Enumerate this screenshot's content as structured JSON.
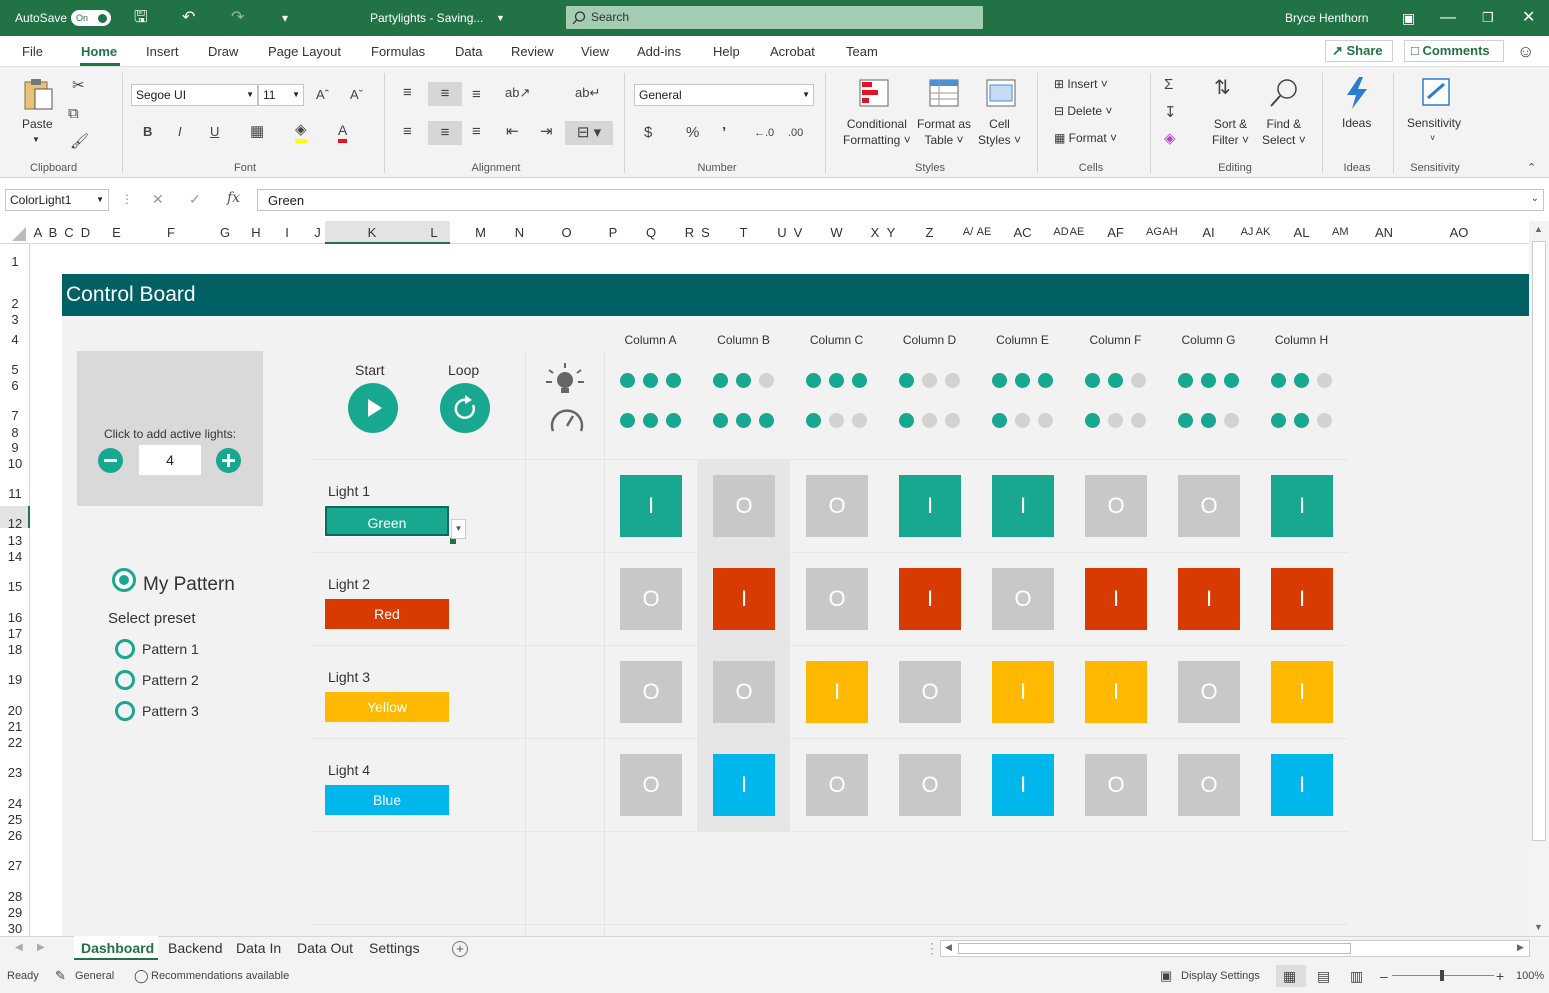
{
  "titlebar": {
    "autosave_label": "AutoSave",
    "autosave_state": "On",
    "doc_title": "Partylights  -  Saving...",
    "search_placeholder": "Search",
    "user": "Bryce Henthorn"
  },
  "menu": {
    "tabs": [
      "File",
      "Home",
      "Insert",
      "Draw",
      "Page Layout",
      "Formulas",
      "Data",
      "Review",
      "View",
      "Add-ins",
      "Help",
      "Acrobat",
      "Team"
    ],
    "active": "Home",
    "share": "Share",
    "comments": "Comments"
  },
  "ribbon": {
    "paste": "Paste",
    "clipboard": "Clipboard",
    "font_name": "Segoe UI",
    "font_size": "11",
    "font": "Font",
    "alignment": "Alignment",
    "number_format": "General",
    "number": "Number",
    "cond_format_1": "Conditional",
    "cond_format_2": "Formatting",
    "format_table_1": "Format as",
    "format_table_2": "Table",
    "cell_styles_1": "Cell",
    "cell_styles_2": "Styles",
    "styles": "Styles",
    "insert": "Insert",
    "delete": "Delete",
    "format": "Format",
    "cells": "Cells",
    "sort_1": "Sort &",
    "sort_2": "Filter",
    "find_1": "Find &",
    "find_2": "Select",
    "editing": "Editing",
    "ideas": "Ideas",
    "ideas_group": "Ideas",
    "sensitivity": "Sensitivity",
    "sensitivity_group": "Sensitivity"
  },
  "formula_bar": {
    "name_box": "ColorLight1",
    "fx": "fx",
    "value": "Green"
  },
  "columns": [
    "A",
    "B",
    "C",
    "D",
    "E",
    "F",
    "G",
    "H",
    "I",
    "J",
    "K",
    "L",
    "M",
    "N",
    "O",
    "P",
    "Q",
    "R",
    "S",
    "T",
    "U",
    "V",
    "W",
    "X",
    "Y",
    "Z",
    "A/",
    "AE",
    "AC",
    "AD",
    "AE",
    "AF",
    "AG",
    "AH",
    "AI",
    "AJ",
    "AK",
    "AL",
    "AM",
    "AN",
    "AO"
  ],
  "rows": [
    "1",
    "2",
    "3",
    "4",
    "5",
    "6",
    "7",
    "8",
    "9",
    "10",
    "11",
    "12",
    "13",
    "14",
    "15",
    "16",
    "17",
    "18",
    "19",
    "20",
    "21",
    "22",
    "23",
    "24",
    "25",
    "26",
    "27",
    "28",
    "29",
    "30"
  ],
  "dashboard": {
    "title": "Control Board",
    "add_lights_label": "Click to add active lights:",
    "active_lights": "4",
    "my_pattern": "My Pattern",
    "select_preset": "Select preset",
    "presets": [
      "Pattern 1",
      "Pattern 2",
      "Pattern 3"
    ],
    "start": "Start",
    "loop": "Loop",
    "column_headers": [
      "Column A",
      "Column B",
      "Column C",
      "Column D",
      "Column E",
      "Column F",
      "Column G",
      "Column H"
    ],
    "lights": [
      {
        "label": "Light 1",
        "color_name": "Green",
        "color": "#17a88f",
        "states": [
          "I",
          "O",
          "O",
          "I",
          "I",
          "O",
          "O",
          "I"
        ]
      },
      {
        "label": "Light 2",
        "color_name": "Red",
        "color": "#d83b01",
        "states": [
          "O",
          "I",
          "O",
          "I",
          "O",
          "I",
          "I",
          "I"
        ]
      },
      {
        "label": "Light 3",
        "color_name": "Yellow",
        "color": "#ffb900",
        "states": [
          "O",
          "O",
          "I",
          "O",
          "I",
          "I",
          "O",
          "I"
        ]
      },
      {
        "label": "Light 4",
        "color_name": "Blue",
        "color": "#00b7eb",
        "states": [
          "O",
          "I",
          "O",
          "O",
          "I",
          "O",
          "O",
          "I"
        ]
      }
    ],
    "off_color": "#c8c8c8",
    "brightness_dots": [
      [
        1,
        1,
        1
      ],
      [
        1,
        1,
        0
      ],
      [
        1,
        1,
        1
      ],
      [
        1,
        0,
        0
      ],
      [
        1,
        1,
        1
      ],
      [
        1,
        1,
        0
      ],
      [
        1,
        1,
        1
      ],
      [
        1,
        1,
        0
      ]
    ],
    "speed_dots": [
      [
        1,
        1,
        1
      ],
      [
        1,
        1,
        1
      ],
      [
        1,
        0,
        0
      ],
      [
        1,
        0,
        0
      ],
      [
        1,
        0,
        0
      ],
      [
        1,
        0,
        0
      ],
      [
        1,
        1,
        0
      ],
      [
        1,
        1,
        0
      ]
    ],
    "teal": "#17a88f"
  },
  "sheet_tabs": [
    "Dashboard",
    "Backend",
    "Data In",
    "Data Out",
    "Settings"
  ],
  "active_sheet": "Dashboard",
  "status": {
    "ready": "Ready",
    "general": "General",
    "recommendations": "Recommendations available",
    "display_settings": "Display Settings",
    "zoom": "100%"
  }
}
